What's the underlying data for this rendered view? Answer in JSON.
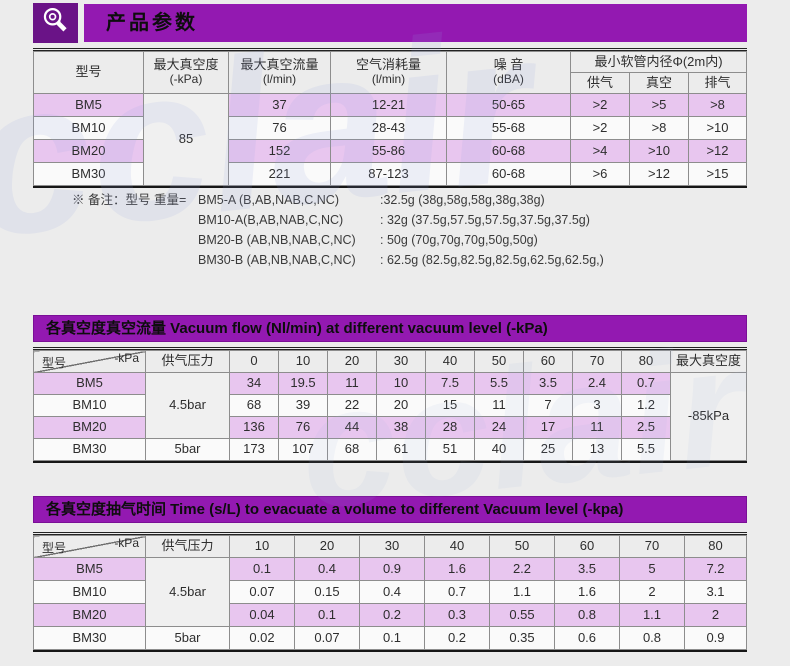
{
  "colors": {
    "banner_purple": "#9319b1",
    "icon_box_purple": "#6a1387",
    "row_pink": "#e8c6ef",
    "page_bg": "#ececec"
  },
  "watermark": {
    "text": "cclair"
  },
  "header": {
    "title": "产品参数",
    "icon": "magnifier-icon"
  },
  "spec_table": {
    "h_model": "型号",
    "h_vac": "最大真空度",
    "h_vac_u": "(-kPa)",
    "h_flow": "最大真空流量",
    "h_flow_u": "(l/min)",
    "h_air": "空气消耗量",
    "h_air_u": "(l/min)",
    "h_noise": "噪 音",
    "h_noise_u": "(dBA)",
    "h_hose": "最小软管内径Φ(2m内)",
    "h_supply": "供气",
    "h_vacuum": "真空",
    "h_exhaust": "排气",
    "shared_vacuum": "85",
    "rows": [
      [
        "BM5",
        "37",
        "12-21",
        "50-65",
        ">2",
        ">5",
        ">8"
      ],
      [
        "BM10",
        "76",
        "28-43",
        "55-68",
        ">2",
        ">8",
        ">10"
      ],
      [
        "BM20",
        "152",
        "55-86",
        "60-68",
        ">4",
        ">10",
        ">12"
      ],
      [
        "BM30",
        "221",
        "87-123",
        "60-68",
        ">6",
        ">12",
        ">15"
      ]
    ]
  },
  "remarks": {
    "prefix": "※ 备注：型号 重量=",
    "items": [
      {
        "model": "BM5-A (B,AB,NAB,C,NC)",
        "weight": ":32.5g (38g,58g,58g,38g,38g)"
      },
      {
        "model": "BM10-A(B,AB,NAB,C,NC)",
        "weight": ": 32g (37.5g,57.5g,57.5g,37.5g,37.5g)"
      },
      {
        "model": "BM20-B (AB,NB,NAB,C,NC)",
        "weight": ": 50g (70g,70g,70g,50g,50g)"
      },
      {
        "model": "BM30-B (AB,NB,NAB,C,NC)",
        "weight": ": 62.5g (82.5g,82.5g,82.5g,62.5g,62.5g,)"
      }
    ]
  },
  "flow_table": {
    "title": "各真空度真空流量 Vacuum flow (Nl/min) at different vacuum level (-kPa)",
    "corner_top": "-kPa",
    "corner_bottom": "型号",
    "h_pressure": "供气压力",
    "levels": [
      "0",
      "10",
      "20",
      "30",
      "40",
      "50",
      "60",
      "70",
      "80"
    ],
    "h_max": "最大真空度",
    "max_value": "-85kPa",
    "p45": "4.5bar",
    "p5": "5bar",
    "rows": [
      [
        "BM5",
        "34",
        "19.5",
        "11",
        "10",
        "7.5",
        "5.5",
        "3.5",
        "2.4",
        "0.7"
      ],
      [
        "BM10",
        "68",
        "39",
        "22",
        "20",
        "15",
        "11",
        "7",
        "3",
        "1.2"
      ],
      [
        "BM20",
        "136",
        "76",
        "44",
        "38",
        "28",
        "24",
        "17",
        "11",
        "2.5"
      ],
      [
        "BM30",
        "173",
        "107",
        "68",
        "61",
        "51",
        "40",
        "25",
        "13",
        "5.5"
      ]
    ]
  },
  "time_table": {
    "title": "各真空度抽气时间 Time (s/L) to evacuate a volume to different Vacuum level (-kpa)",
    "corner_top": "-kPa",
    "corner_bottom": "型号",
    "h_pressure": "供气压力",
    "levels": [
      "10",
      "20",
      "30",
      "40",
      "50",
      "60",
      "70",
      "80"
    ],
    "p45": "4.5bar",
    "p5": "5bar",
    "rows": [
      [
        "BM5",
        "0.1",
        "0.4",
        "0.9",
        "1.6",
        "2.2",
        "3.5",
        "5",
        "7.2"
      ],
      [
        "BM10",
        "0.07",
        "0.15",
        "0.4",
        "0.7",
        "1.1",
        "1.6",
        "2",
        "3.1"
      ],
      [
        "BM20",
        "0.04",
        "0.1",
        "0.2",
        "0.3",
        "0.55",
        "0.8",
        "1.1",
        "2"
      ],
      [
        "BM30",
        "0.02",
        "0.07",
        "0.1",
        "0.2",
        "0.35",
        "0.6",
        "0.8",
        "0.9"
      ]
    ]
  }
}
